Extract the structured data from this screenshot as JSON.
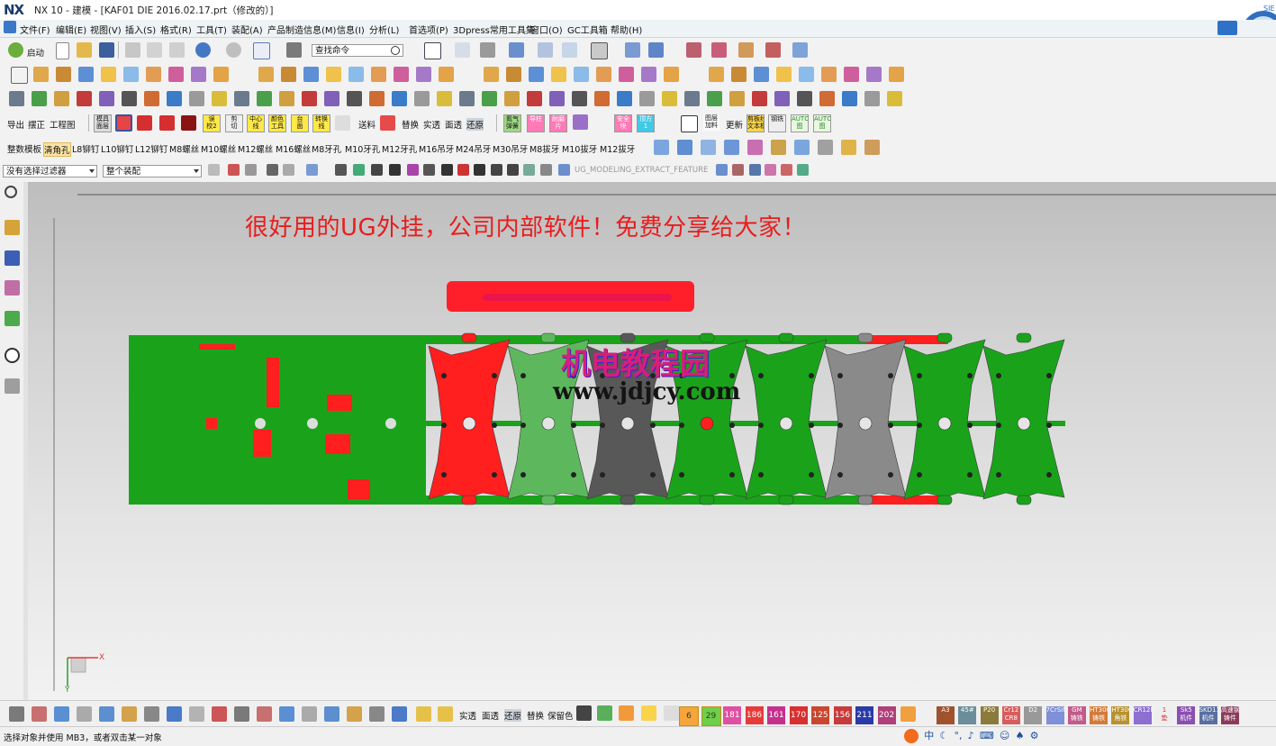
{
  "window": {
    "logo": "NX",
    "title": "NX 10 - 建模 - [KAF01 DIE 2016.02.17.prt（修改的）]"
  },
  "menu": {
    "items": [
      "文件(F)",
      "编辑(E)",
      "视图(V)",
      "插入(S)",
      "格式(R)",
      "工具(T)",
      "装配(A)",
      "产品制造信息(M)",
      "信息(I)",
      "分析(L)",
      "首选项(P)",
      "3Dpress常用工具集",
      "窗口(O)",
      "GC工具箱",
      "帮助(H)"
    ]
  },
  "toolbar1": {
    "start_label": "启动",
    "search_placeholder": "查找命令"
  },
  "toolbar4": {
    "export_label": "导出",
    "correct_label": "摆正",
    "drawing_label": "工程图",
    "feed_label": "送料",
    "replace_label": "替换",
    "solid_label": "实透",
    "surface_label": "面透",
    "restore_label": "还原",
    "update_label": "更新",
    "tiles": [
      "模具\n面层",
      "误\n校2",
      "剪\n切",
      "中心\n线",
      "颜色\n工具",
      "台\n面",
      "转换\n线",
      "氮气\n弹簧",
      "导柱",
      "耐磨\n片",
      "安全\n块",
      "顶方\n1",
      "图层\n加料",
      "剪板线\n文本框",
      "钢铣",
      "AUTO\n图",
      "AUTO\n图"
    ]
  },
  "toolbar5": {
    "items": [
      "整数模板",
      "清角孔",
      "L8铆钉",
      "L10铆钉",
      "L12铆钉",
      "M8螺丝",
      "M10螺丝",
      "M12螺丝",
      "M16螺丝",
      "M8牙孔",
      "M10牙孔",
      "M12牙孔",
      "M16吊牙",
      "M24吊牙",
      "M30吊牙",
      "M8拔牙",
      "M10拔牙",
      "M12拔牙"
    ],
    "active_item": "清角孔"
  },
  "selection_bar": {
    "filter_value": "没有选择过滤器",
    "scope_value": "整个装配",
    "feature_label": "UG_MODELING_EXTRACT_FEATURE"
  },
  "canvas": {
    "headline": "很好用的UG外挂，公司内部软件！免费分享给大家！",
    "watermark_cn": "机电教程园",
    "watermark_url": "www.jdjcy.com",
    "triad_x": "X",
    "triad_y": "Y",
    "colors": {
      "strip_green": "#1aa31a",
      "strip_red": "#ff1f1f",
      "light_green": "#5db85d",
      "dark_gray": "#585858",
      "mid_gray": "#8a8a8a",
      "headline": "#ea1c1c"
    }
  },
  "bottom_toolbar": {
    "solid_label": "实透",
    "surface_label": "面透",
    "restore_label": "还原",
    "replace_label": "替换",
    "keep_color_label": "保留色",
    "numbers": [
      "6",
      "29",
      "181",
      "186",
      "161",
      "170",
      "125",
      "156",
      "211",
      "202"
    ],
    "small_tiles": [
      "A3",
      "45#",
      "P20",
      "Cr12\nCR8",
      "D2",
      "7CrSiMnMoV",
      "GM\n铸铁",
      "HT300\n铸铁",
      "HT300\n角铁",
      "CR12MoV",
      "1\n垫",
      "Sk5\n机件",
      "SKD11\n机件",
      "高速钢\n铸件"
    ]
  },
  "status": {
    "message": "选择对象并使用 MB3，或者双击某一对象",
    "ime_label": "中"
  }
}
